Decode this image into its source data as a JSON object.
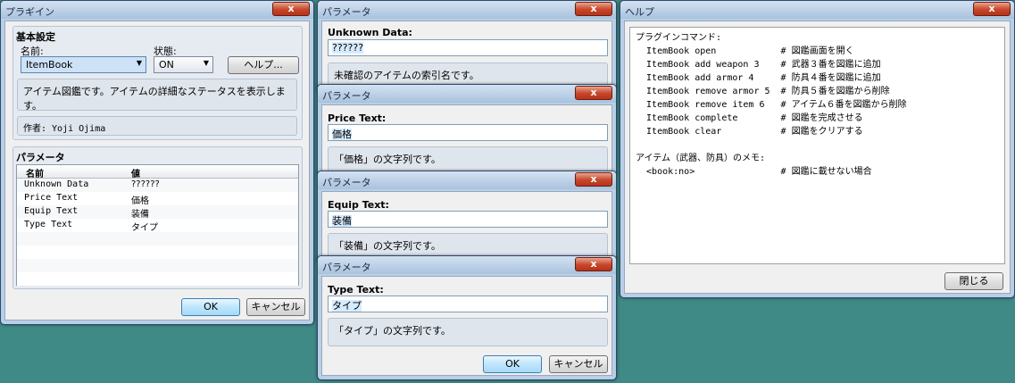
{
  "plugin_window": {
    "title": "プラギイン",
    "close": "x",
    "basic_group": "基本設定",
    "name_label": "名前:",
    "status_label": "状態:",
    "name_value": "ItemBook",
    "status_value": "ON",
    "help_button": "ヘルプ...",
    "description": "アイテム図鑑です。アイテムの詳細なステータスを表示します。",
    "author": "作者: Yoji Ojima",
    "params_group": "パラメータ",
    "col_name": "名前",
    "col_value": "値",
    "rows": [
      {
        "name": "Unknown Data",
        "value": "??????"
      },
      {
        "name": "Price Text",
        "value": "価格"
      },
      {
        "name": "Equip Text",
        "value": "装備"
      },
      {
        "name": "Type Text",
        "value": "タイプ"
      }
    ],
    "ok": "OK",
    "cancel": "キャンセル"
  },
  "param_windows": [
    {
      "title": "パラメータ",
      "label": "Unknown Data:",
      "value": "??????",
      "desc": "未確認のアイテムの索引名です。"
    },
    {
      "title": "パラメータ",
      "label": "Price Text:",
      "value": "価格",
      "desc": "「価格」の文字列です。"
    },
    {
      "title": "パラメータ",
      "label": "Equip Text:",
      "value": "装備",
      "desc": "「装備」の文字列です。"
    },
    {
      "title": "パラメータ",
      "label": "Type Text:",
      "value": "タイプ",
      "desc": "「タイプ」の文字列です。",
      "ok": "OK",
      "cancel": "キャンセル"
    }
  ],
  "help_window": {
    "title": "ヘルプ",
    "text": "プラグインコマンド:\n  ItemBook open            # 図鑑画面を開く\n  ItemBook add weapon 3    # 武器３番を図鑑に追加\n  ItemBook add armor 4     # 防具４番を図鑑に追加\n  ItemBook remove armor 5  # 防具５番を図鑑から削除\n  ItemBook remove item 6   # アイテム６番を図鑑から削除\n  ItemBook complete        # 図鑑を完成させる\n  ItemBook clear           # 図鑑をクリアする\n\nアイテム（武器、防具）のメモ:\n  <book:no>                # 図鑑に載せない場合",
    "close_button": "閉じる"
  }
}
